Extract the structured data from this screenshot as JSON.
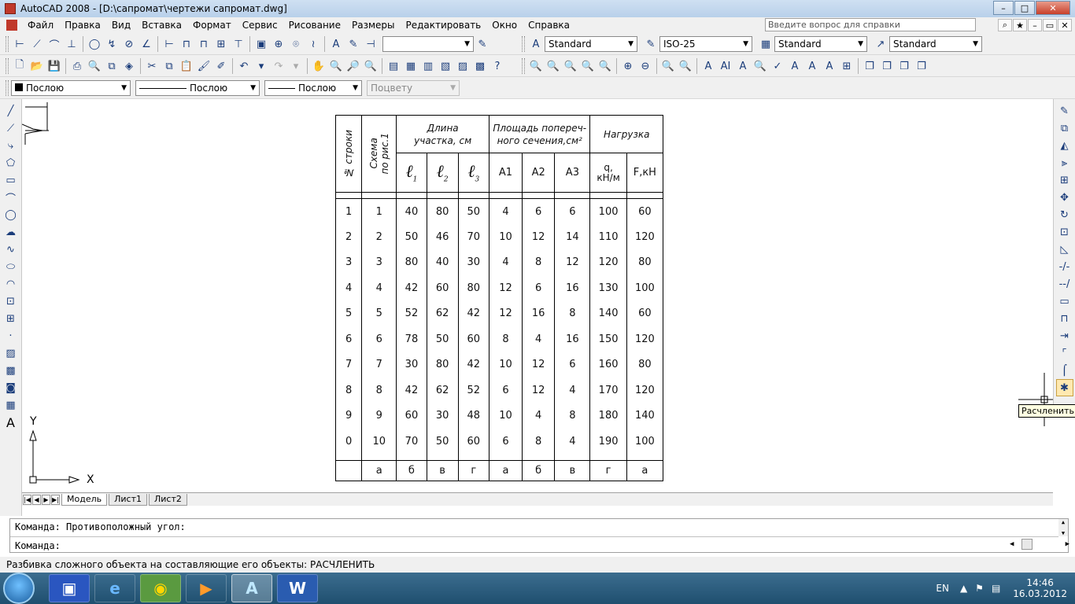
{
  "window": {
    "title": "AutoCAD 2008 - [D:\\сапромат\\чертежи сапромат.dwg]",
    "controls": {
      "minimize": "–",
      "maximize": "□",
      "close": "✕"
    }
  },
  "menubar": {
    "items": [
      "Файл",
      "Правка",
      "Вид",
      "Вставка",
      "Формат",
      "Сервис",
      "Рисование",
      "Размеры",
      "Редактировать",
      "Окно",
      "Справка"
    ],
    "help_placeholder": "Введите вопрос для справки",
    "doc_controls": {
      "minimize": "–",
      "restore": "▭",
      "close": "✕"
    }
  },
  "styles_toolbar": {
    "text_style": "Standard",
    "dim_style": "ISO-25",
    "table_style": "Standard",
    "multileader_style": "Standard"
  },
  "layers_toolbar": {
    "color": "Послою",
    "linetype": "Послою",
    "lineweight": "Послою",
    "plotstyle": "Поцвету"
  },
  "layout_tabs": [
    "Модель",
    "Лист1",
    "Лист2"
  ],
  "ucs": {
    "x_label": "X",
    "y_label": "Y"
  },
  "command": {
    "line1": "Команда: Противоположный угол:",
    "line2": "Команда:"
  },
  "tooltip": "Расчленить",
  "status": "Разбивка сложного объекта на составляющие его объекты:  РАСЧЛЕНИТЬ",
  "taskbar": {
    "lang": "EN",
    "time": "14:46",
    "date": "16.03.2012",
    "apps": [
      "save-icon",
      "ie-icon",
      "autocad-launcher-icon",
      "media-icon",
      "autocad-icon",
      "word-icon"
    ]
  },
  "table": {
    "header": {
      "row_no": "№ строки",
      "scheme": "Схема\nпо рис.1",
      "length_group": "Длина\nучастка, см",
      "area_group": "Площадь попереч-\nного сечения,см²",
      "load_group": "Нагрузка",
      "l1": "1",
      "l2": "2",
      "l3": "3",
      "a1": "A1",
      "a2": "A2",
      "a3": "A3",
      "q": "q,\nкН/м",
      "f": "F,кН"
    },
    "rows": [
      [
        "1",
        "1",
        "40",
        "80",
        "50",
        "4",
        "6",
        "6",
        "100",
        "60"
      ],
      [
        "2",
        "2",
        "50",
        "46",
        "70",
        "10",
        "12",
        "14",
        "110",
        "120"
      ],
      [
        "3",
        "3",
        "80",
        "40",
        "30",
        "4",
        "8",
        "12",
        "120",
        "80"
      ],
      [
        "4",
        "4",
        "42",
        "60",
        "80",
        "12",
        "6",
        "16",
        "130",
        "100"
      ],
      [
        "5",
        "5",
        "52",
        "62",
        "42",
        "12",
        "16",
        "8",
        "140",
        "60"
      ],
      [
        "6",
        "6",
        "78",
        "50",
        "60",
        "8",
        "4",
        "16",
        "150",
        "120"
      ],
      [
        "7",
        "7",
        "30",
        "80",
        "42",
        "10",
        "12",
        "6",
        "160",
        "80"
      ],
      [
        "8",
        "8",
        "42",
        "62",
        "52",
        "6",
        "12",
        "4",
        "170",
        "120"
      ],
      [
        "9",
        "9",
        "60",
        "30",
        "48",
        "10",
        "4",
        "8",
        "180",
        "140"
      ],
      [
        "0",
        "10",
        "70",
        "50",
        "60",
        "6",
        "8",
        "4",
        "190",
        "100"
      ]
    ],
    "footer": [
      "",
      "а",
      "б",
      "в",
      "г",
      "а",
      "б",
      "в",
      "г",
      "а"
    ]
  }
}
